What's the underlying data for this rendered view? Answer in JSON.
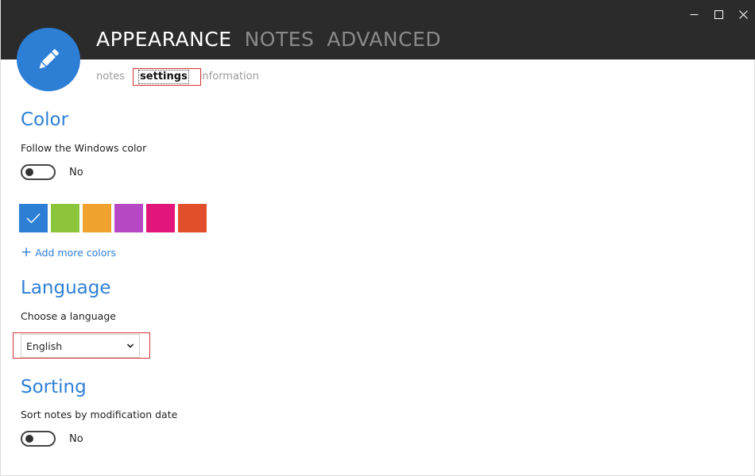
{
  "header": {
    "tabs": [
      {
        "label": "APPEARANCE",
        "active": true
      },
      {
        "label": "NOTES",
        "active": false
      },
      {
        "label": "ADVANCED",
        "active": false
      }
    ],
    "window_controls": [
      "minimize-icon",
      "maximize-icon",
      "close-icon"
    ],
    "background": "#2b2b2b"
  },
  "logo": {
    "icon": "pencil-icon",
    "color": "#2d7fd6"
  },
  "sub_tabs": [
    {
      "label": "notes",
      "active": false
    },
    {
      "label": "settings",
      "active": true
    },
    {
      "label": "information",
      "active": false
    }
  ],
  "color_section": {
    "title": "Color",
    "follow_label": "Follow the Windows color",
    "toggle_state": "No",
    "swatches": [
      {
        "color": "#2d7fd6",
        "selected": true
      },
      {
        "color": "#8cc43c",
        "selected": false
      },
      {
        "color": "#f0a22e",
        "selected": false
      },
      {
        "color": "#b648c4",
        "selected": false
      },
      {
        "color": "#e0167a",
        "selected": false
      },
      {
        "color": "#e04e2a",
        "selected": false
      }
    ],
    "add_more_label": "Add more colors"
  },
  "language_section": {
    "title": "Language",
    "choose_label": "Choose a language",
    "selected": "English"
  },
  "sorting_section": {
    "title": "Sorting",
    "sort_label": "Sort notes by modification date",
    "toggle_state": "No"
  },
  "colors": {
    "accent": "#2d7fd6",
    "highlight_border": "#d13438"
  }
}
